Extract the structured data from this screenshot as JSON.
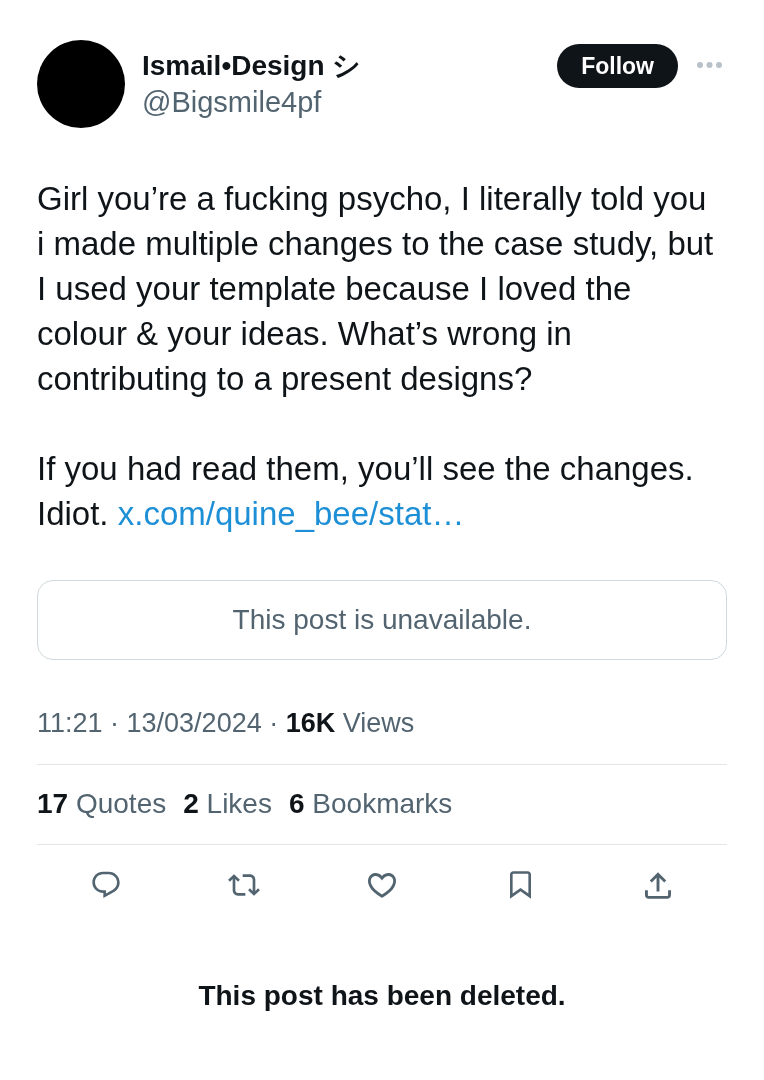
{
  "post": {
    "author": {
      "name": "Ismail•Design シ",
      "handle": "@Bigsmile4pf"
    },
    "follow_button": "Follow",
    "body": [
      {
        "text": "Girl you’re a fucking psycho, I literally told you i made multiple changes to the case study, but I used your template because I loved the colour & your ideas. What’s wrong in contributing to a present designs?"
      },
      {
        "text": "If you had read them, you’ll see the changes. Idiot.",
        "link": "x.com/quine_bee/stat…"
      }
    ],
    "quoted_post": {
      "message": "This post is unavailable."
    },
    "meta": "11:21 · 13/03/2024 · **16K** Views",
    "stats": [
      "**17** Quotes",
      "**2** Likes",
      "**6** Bookmarks"
    ],
    "actions": [
      {
        "kind": "reply"
      },
      {
        "kind": "repost"
      },
      {
        "kind": "like"
      },
      {
        "kind": "bookmark"
      },
      {
        "kind": "share"
      }
    ]
  },
  "notice": "This post has been deleted."
}
